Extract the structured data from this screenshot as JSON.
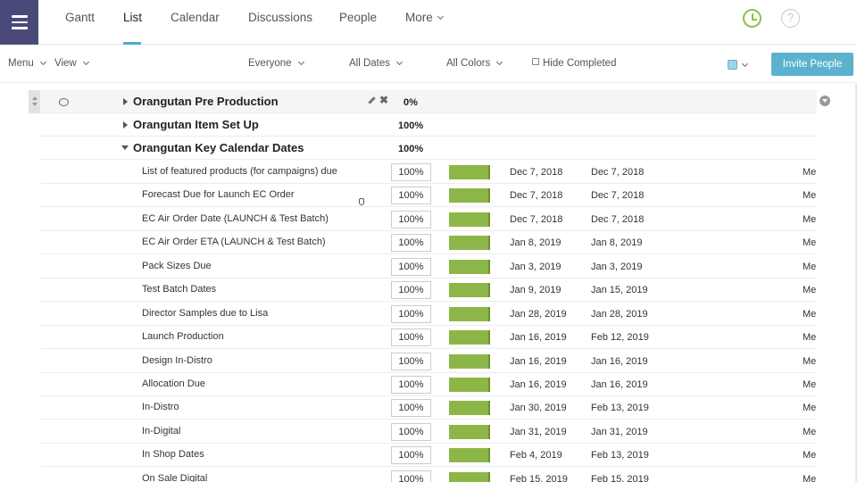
{
  "nav": {
    "tabs": [
      {
        "label": "Gantt"
      },
      {
        "label": "List"
      },
      {
        "label": "Calendar"
      },
      {
        "label": "Discussions"
      },
      {
        "label": "People"
      },
      {
        "label": "More"
      }
    ],
    "help_symbol": "?"
  },
  "toolbar": {
    "menu": "Menu",
    "view": "View",
    "everyone": "Everyone",
    "all_dates": "All Dates",
    "all_colors": "All Colors",
    "hide_completed": "Hide Completed",
    "invite": "Invite People",
    "swatch_color": "#9fd4e8"
  },
  "groups": [
    {
      "name": "Orangutan Pre Production",
      "pct": "0%"
    },
    {
      "name": "Orangutan Item Set Up",
      "pct": "100%"
    },
    {
      "name": "Orangutan Key Calendar Dates",
      "pct": "100%"
    }
  ],
  "tasks": [
    {
      "name": "List of featured products (for campaigns) due",
      "pct": "100%",
      "start": "Dec 7, 2018",
      "end": "Dec 7, 2018",
      "assignee": "Me"
    },
    {
      "name": "Forecast Due for Launch EC Order",
      "pct": "100%",
      "start": "Dec 7, 2018",
      "end": "Dec 7, 2018",
      "assignee": "Me"
    },
    {
      "name": "EC Air Order Date (LAUNCH & Test Batch)",
      "pct": "100%",
      "start": "Dec 7, 2018",
      "end": "Dec 7, 2018",
      "assignee": "Me"
    },
    {
      "name": "EC Air Order ETA (LAUNCH & Test Batch)",
      "pct": "100%",
      "start": "Jan 8, 2019",
      "end": "Jan 8, 2019",
      "assignee": "Me"
    },
    {
      "name": "Pack Sizes Due",
      "pct": "100%",
      "start": "Jan 3, 2019",
      "end": "Jan 3, 2019",
      "assignee": "Me"
    },
    {
      "name": "Test Batch Dates",
      "pct": "100%",
      "start": "Jan 9, 2019",
      "end": "Jan 15, 2019",
      "assignee": "Me"
    },
    {
      "name": "Director Samples due to Lisa",
      "pct": "100%",
      "start": "Jan 28, 2019",
      "end": "Jan 28, 2019",
      "assignee": "Me"
    },
    {
      "name": "Launch Production",
      "pct": "100%",
      "start": "Jan 16, 2019",
      "end": "Feb 12, 2019",
      "assignee": "Me"
    },
    {
      "name": "Design In-Distro",
      "pct": "100%",
      "start": "Jan 16, 2019",
      "end": "Jan 16, 2019",
      "assignee": "Me"
    },
    {
      "name": "Allocation Due",
      "pct": "100%",
      "start": "Jan 16, 2019",
      "end": "Jan 16, 2019",
      "assignee": "Me"
    },
    {
      "name": "In-Distro",
      "pct": "100%",
      "start": "Jan 30, 2019",
      "end": "Feb 13, 2019",
      "assignee": "Me"
    },
    {
      "name": "In-Digital",
      "pct": "100%",
      "start": "Jan 31, 2019",
      "end": "Jan 31, 2019",
      "assignee": "Me"
    },
    {
      "name": "In Shop Dates",
      "pct": "100%",
      "start": "Feb 4, 2019",
      "end": "Feb 13, 2019",
      "assignee": "Me"
    },
    {
      "name": "On Sale Digital",
      "pct": "100%",
      "start": "Feb 15, 2019",
      "end": "Feb 15, 2019",
      "assignee": "Me"
    }
  ],
  "colors": {
    "accent": "#5ab2cf",
    "progress_bar": "#8db648",
    "menu_bg": "#4a4a7a",
    "clock": "#8cc13f"
  }
}
